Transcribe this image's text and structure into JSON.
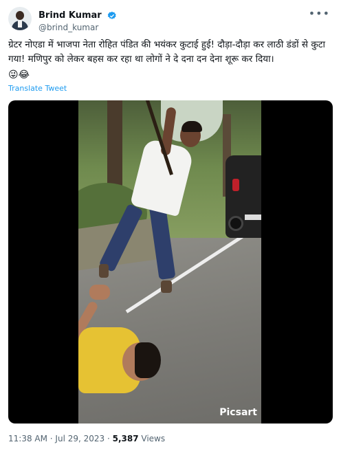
{
  "user": {
    "display_name": "Brind Kumar",
    "handle": "@brind_kumar",
    "verified": true
  },
  "tweet": {
    "text": "ग्रेटर नोएडा में भाजपा नेता रोहित पंडित की भयंकर कुटाई हुई! दौड़ा-दौड़ा कर लाठी डंडों से कुटा गया! मणिपुर को लेकर बहस कर रहा था लोगों ने दे दना दन देना शूरू कर दिया।",
    "emojis": "😜😂",
    "translate_label": "Translate Tweet"
  },
  "media": {
    "watermark": "Picsart"
  },
  "meta": {
    "time": "11:38 AM",
    "separator1": " · ",
    "date": "Jul 29, 2023",
    "separator2": " · ",
    "views_count": "5,387",
    "views_label": " Views"
  },
  "icons": {
    "verified": "verified-badge-icon",
    "more": "more-options-icon"
  },
  "colors": {
    "accent": "#1d9bf0",
    "secondary_text": "#536471",
    "primary_text": "#0f1419"
  }
}
